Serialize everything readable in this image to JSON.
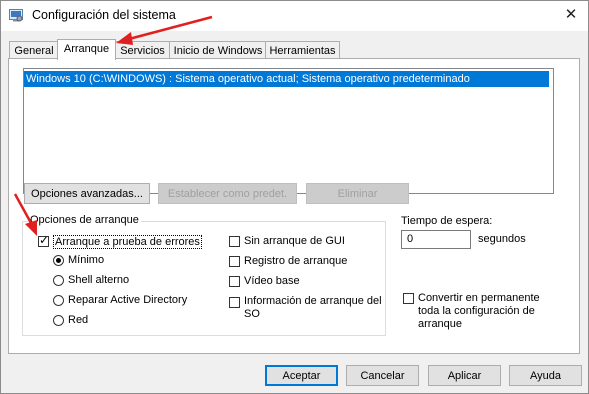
{
  "window": {
    "title": "Configuración del sistema",
    "close_symbol": "✕"
  },
  "tabs": [
    {
      "label": "General"
    },
    {
      "label": "Arranque"
    },
    {
      "label": "Servicios"
    },
    {
      "label": "Inicio de Windows"
    },
    {
      "label": "Herramientas"
    }
  ],
  "active_tab": "Arranque",
  "boot_list": {
    "items": [
      "Windows 10 (C:\\WINDOWS) : Sistema operativo actual; Sistema operativo predeterminado"
    ],
    "selected_index": 0
  },
  "boot_buttons": {
    "advanced": "Opciones avanzadas...",
    "set_default": "Establecer como predet.",
    "delete": "Eliminar"
  },
  "boot_options": {
    "group_label": "Opciones de arranque",
    "safe_boot": {
      "label": "Arranque a prueba de errores",
      "checked": true
    },
    "radios": [
      {
        "label": "Mínimo",
        "selected": true
      },
      {
        "label": "Shell alterno",
        "selected": false
      },
      {
        "label": "Reparar Active Directory",
        "selected": false
      },
      {
        "label": "Red",
        "selected": false
      }
    ],
    "no_gui": {
      "label": "Sin arranque de GUI",
      "checked": false
    },
    "boot_log": {
      "label": "Registro de arranque",
      "checked": false
    },
    "base_video": {
      "label": "Vídeo base",
      "checked": false
    },
    "os_boot_info": {
      "label": "Información de arranque del SO",
      "checked": false
    }
  },
  "timeout": {
    "label": "Tiempo de espera:",
    "value": "0",
    "unit": "segundos"
  },
  "make_permanent": {
    "label": "Convertir en permanente toda la configuración de arranque",
    "checked": false
  },
  "footer_buttons": {
    "ok": "Aceptar",
    "cancel": "Cancelar",
    "apply": "Aplicar",
    "help": "Ayuda"
  },
  "colors": {
    "selection": "#0078d7",
    "annotation_arrow": "#e02020"
  },
  "icons": {
    "app": "msconfig-icon",
    "close": "close-icon"
  }
}
